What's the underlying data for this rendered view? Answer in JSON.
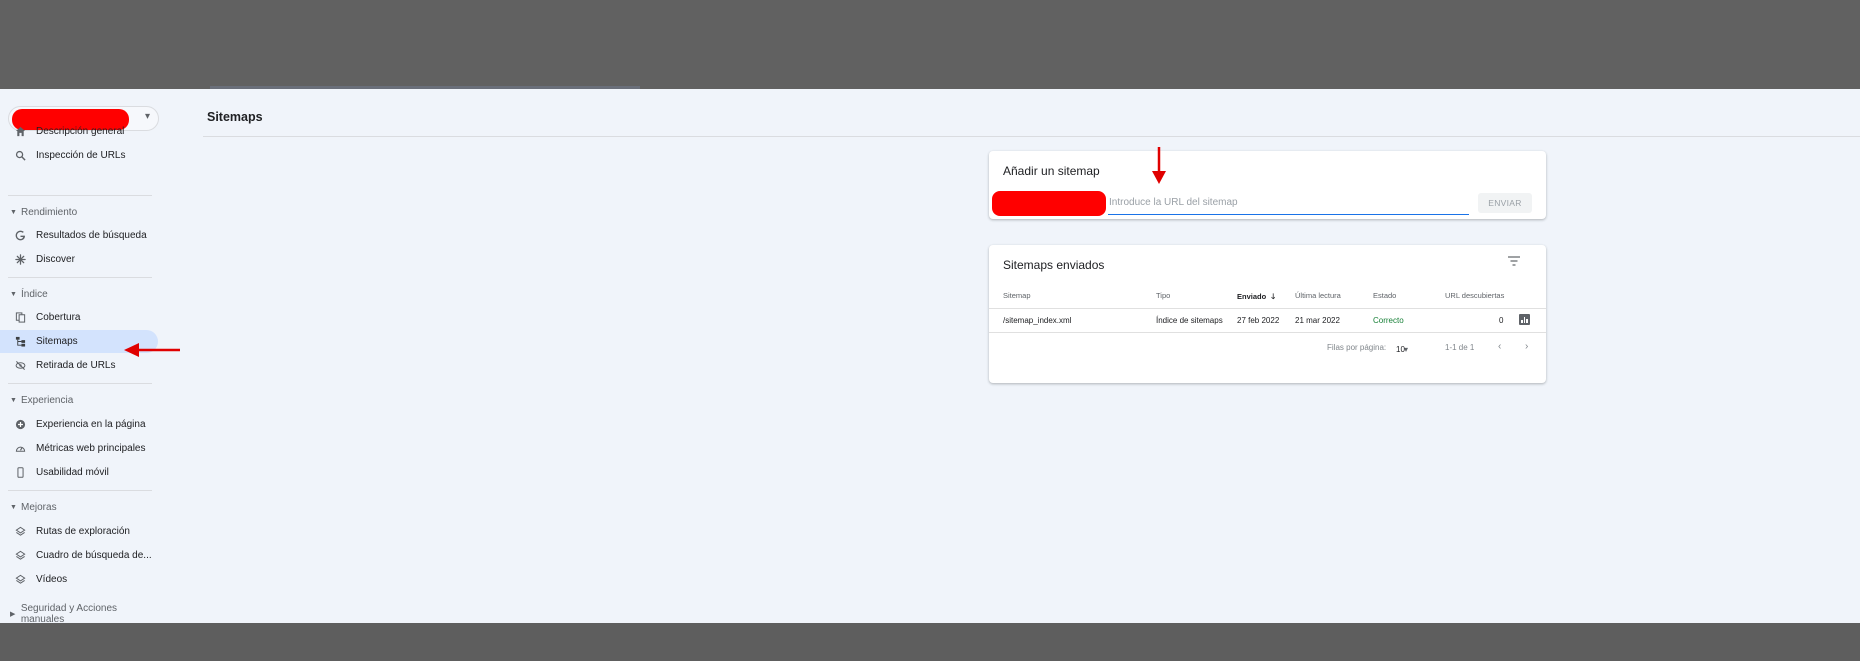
{
  "sidebar": {
    "overview": "Descripción general",
    "url_inspection": "Inspección de URLs",
    "sections": {
      "performance": "Rendimiento",
      "index": "Índice",
      "experience": "Experiencia",
      "enhancements": "Mejoras",
      "security": "Seguridad y Acciones manuales"
    },
    "items": {
      "search_results": "Resultados de búsqueda",
      "discover": "Discover",
      "coverage": "Cobertura",
      "sitemaps": "Sitemaps",
      "removals": "Retirada de URLs",
      "page_experience": "Experiencia en la página",
      "core_web_vitals": "Métricas web principales",
      "mobile_usability": "Usabilidad móvil",
      "breadcrumbs": "Rutas de exploración",
      "sitelinks_searchbox": "Cuadro de búsqueda de...",
      "videos": "Vídeos"
    }
  },
  "page": {
    "title": "Sitemaps"
  },
  "add_sitemap": {
    "title": "Añadir un sitemap",
    "input_placeholder": "Introduce la URL del sitemap",
    "input_value": "",
    "submit_label": "ENVIAR"
  },
  "submitted": {
    "title": "Sitemaps enviados",
    "columns": {
      "sitemap": "Sitemap",
      "type": "Tipo",
      "submitted": "Enviado",
      "last_read": "Última lectura",
      "status": "Estado",
      "discovered": "URL descubiertas"
    },
    "rows": [
      {
        "sitemap": "/sitemap_index.xml",
        "type": "Índice de sitemaps",
        "submitted": "27 feb 2022",
        "last_read": "21 mar 2022",
        "status": "Correcto",
        "discovered": "0"
      }
    ],
    "pagination": {
      "rows_per_page_label": "Filas por página:",
      "rows_per_page_value": "10",
      "range": "1-1 de 1"
    }
  },
  "colors": {
    "accent": "#1a73e8",
    "active_nav": "#d3e3fd",
    "status_ok": "#188038",
    "redaction": "#ff0000",
    "annotation_arrow": "#e00000"
  }
}
